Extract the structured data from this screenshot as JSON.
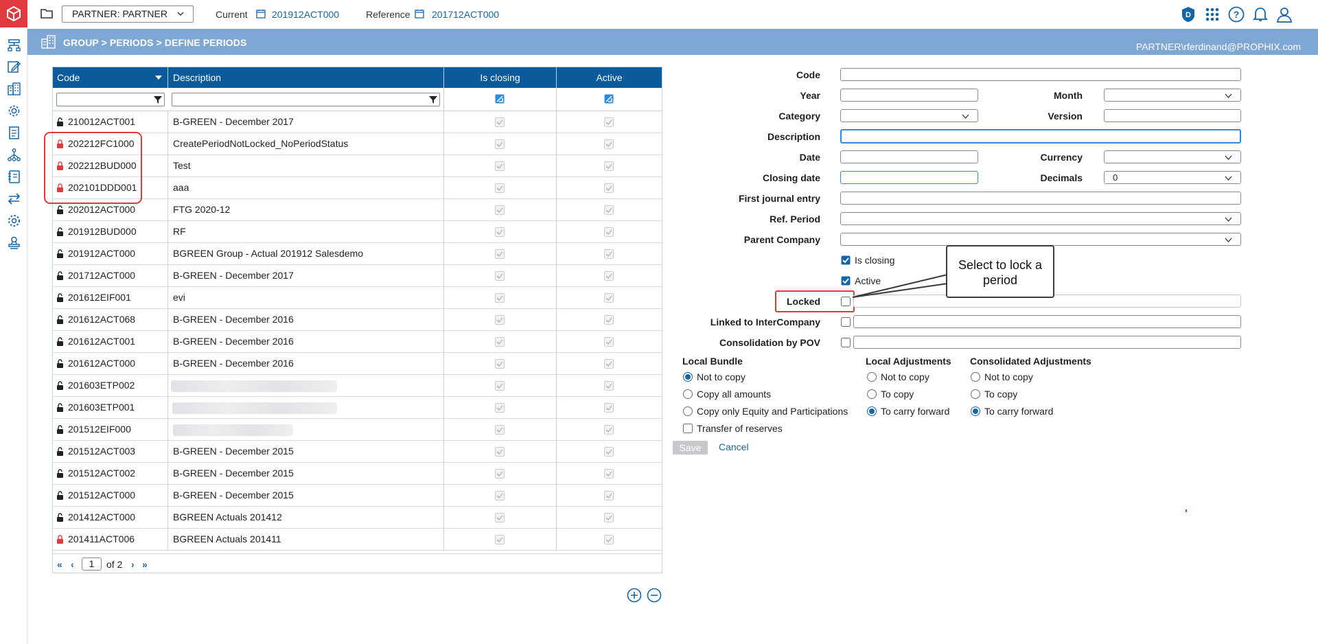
{
  "topbar": {
    "partner_select": "PARTNER: PARTNER",
    "current_label": "Current",
    "current_value": "201912ACT000",
    "reference_label": "Reference",
    "reference_value": "201712ACT000",
    "icons": [
      "folder-icon",
      "calendar-icon",
      "d-badge-icon",
      "apps-grid-icon",
      "help-icon",
      "bell-icon",
      "user-icon"
    ]
  },
  "band": {
    "breadcrumb": "GROUP > PERIODS > DEFINE PERIODS",
    "user": "PARTNER\\rferdinand@PROPHIX.com"
  },
  "sidebar": {
    "icons": [
      "structure-icon",
      "edit-icon",
      "buildings-icon",
      "settings-gear-icon",
      "document-icon",
      "hierarchy-icon",
      "journal-icon",
      "transfer-icon",
      "admin-gear-icon",
      "stamp-icon"
    ]
  },
  "grid": {
    "columns": [
      "Code",
      "Description",
      "Is closing",
      "Active"
    ],
    "rows": [
      {
        "code": "210012ACT001",
        "description": "B-GREEN - December 2017",
        "locked": false,
        "is_closing": true,
        "active": true
      },
      {
        "code": "202212FC1000",
        "description": "CreatePeriodNotLocked_NoPeriodStatus",
        "locked": true,
        "is_closing": true,
        "active": true
      },
      {
        "code": "202212BUD000",
        "description": "Test",
        "locked": true,
        "is_closing": true,
        "active": true
      },
      {
        "code": "202101DDD001",
        "description": "aaa",
        "locked": true,
        "is_closing": true,
        "active": true
      },
      {
        "code": "202012ACT000",
        "description": "FTG 2020-12",
        "locked": false,
        "is_closing": true,
        "active": true
      },
      {
        "code": "201912BUD000",
        "description": "RF",
        "locked": false,
        "is_closing": true,
        "active": true
      },
      {
        "code": "201912ACT000",
        "description": "BGREEN Group - Actual 201912 Salesdemo",
        "locked": false,
        "is_closing": true,
        "active": true
      },
      {
        "code": "201712ACT000",
        "description": "B-GREEN - December 2017",
        "locked": false,
        "is_closing": true,
        "active": true
      },
      {
        "code": "201612EIF001",
        "description": "evi",
        "locked": false,
        "is_closing": true,
        "active": true
      },
      {
        "code": "201612ACT068",
        "description": "B-GREEN - December 2016",
        "locked": false,
        "is_closing": true,
        "active": true
      },
      {
        "code": "201612ACT001",
        "description": "B-GREEN - December 2016",
        "locked": false,
        "is_closing": true,
        "active": true
      },
      {
        "code": "201612ACT000",
        "description": "B-GREEN - December 2016",
        "locked": false,
        "is_closing": true,
        "active": true
      },
      {
        "code": "201603ETP002",
        "description": "",
        "locked": false,
        "is_closing": true,
        "active": true
      },
      {
        "code": "201603ETP001",
        "description": "",
        "locked": false,
        "is_closing": true,
        "active": true
      },
      {
        "code": "201512EIF000",
        "description": "",
        "locked": false,
        "is_closing": true,
        "active": true
      },
      {
        "code": "201512ACT003",
        "description": "B-GREEN - December 2015",
        "locked": false,
        "is_closing": true,
        "active": true
      },
      {
        "code": "201512ACT002",
        "description": "B-GREEN - December 2015",
        "locked": false,
        "is_closing": true,
        "active": true
      },
      {
        "code": "201512ACT000",
        "description": "B-GREEN - December 2015",
        "locked": false,
        "is_closing": true,
        "active": true
      },
      {
        "code": "201412ACT000",
        "description": "BGREEN Actuals 201412",
        "locked": false,
        "is_closing": true,
        "active": true
      },
      {
        "code": "201411ACT006",
        "description": "BGREEN Actuals 201411",
        "locked": true,
        "is_closing": true,
        "active": true
      }
    ],
    "pager": {
      "page": "1",
      "of_label": "of 2"
    }
  },
  "form": {
    "labels": {
      "code": "Code",
      "year": "Year",
      "month": "Month",
      "category": "Category",
      "version": "Version",
      "description": "Description",
      "date": "Date",
      "currency": "Currency",
      "closing_date": "Closing date",
      "decimals": "Decimals",
      "first_journal": "First journal entry",
      "ref_period": "Ref. Period",
      "parent_company": "Parent Company",
      "locked": "Locked",
      "linked_ic": "Linked to InterCompany",
      "consolidation_pov": "Consolidation by POV"
    },
    "values": {
      "decimals": "0"
    },
    "checks": {
      "is_closing": "Is closing",
      "active": "Active"
    },
    "local_bundle": {
      "title": "Local Bundle",
      "options": [
        "Not to copy",
        "Copy all amounts",
        "Copy only Equity and Participations"
      ],
      "selected": 0,
      "transfer": "Transfer of reserves"
    },
    "local_adjustments": {
      "title": "Local Adjustments",
      "options": [
        "Not to copy",
        "To copy",
        "To carry forward"
      ],
      "selected": 2
    },
    "consolidated_adjustments": {
      "title": "Consolidated Adjustments",
      "options": [
        "Not to copy",
        "To copy",
        "To carry forward"
      ],
      "selected": 2
    },
    "save": "Save",
    "cancel": "Cancel"
  },
  "callout": {
    "text": "Select to lock a period"
  },
  "colors": {
    "brand_red": "#e0393e",
    "header_blue": "#0a5a9c",
    "band_blue": "#7fa7d4",
    "link_blue": "#1565a7"
  }
}
